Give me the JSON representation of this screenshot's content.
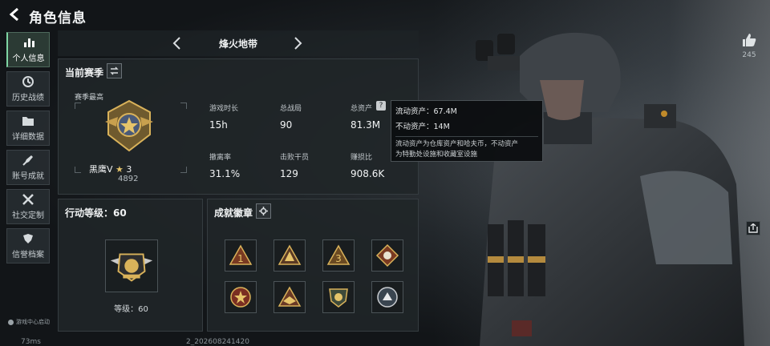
{
  "header": {
    "title": "角色信息",
    "back_icon": "back-arrow-icon"
  },
  "nav": {
    "items": [
      {
        "label": "个人信息",
        "icon": "bar-chart-icon",
        "active": true
      },
      {
        "label": "历史战绩",
        "icon": "history-clock-icon",
        "active": false
      },
      {
        "label": "详细数据",
        "icon": "folder-icon",
        "active": false
      },
      {
        "label": "账号成就",
        "icon": "rocket-icon",
        "active": false
      },
      {
        "label": "社交定制",
        "icon": "tools-icon",
        "active": false
      },
      {
        "label": "信誉档案",
        "icon": "shield-icon",
        "active": false
      }
    ],
    "game_center": "游戏中心启动"
  },
  "mode": {
    "title": "烽火地带"
  },
  "season": {
    "title": "当前赛季",
    "subtitle": "赛季最高",
    "rank_name": "黑鹰V",
    "rank_star": "★",
    "rank_stars": "3",
    "rank_score": "4892",
    "stats": [
      {
        "label": "游戏时长",
        "value": "15h"
      },
      {
        "label": "总战局",
        "value": "90"
      },
      {
        "label": "总资产",
        "value": "81.3M"
      },
      {
        "label": "撤离率",
        "value": "31.1%"
      },
      {
        "label": "击败干员",
        "value": "129"
      },
      {
        "label": "赚损比",
        "value": "908.6K"
      }
    ]
  },
  "tooltip": {
    "liquid": "流动资产：67.4M",
    "fixed": "不动资产：14M",
    "desc1": "流动资产为仓库资产和哈夫币，不动资产",
    "desc2": "为特勤处设施和收藏室设施"
  },
  "level": {
    "title": "行动等级：60",
    "label": "等级：60"
  },
  "achievements": {
    "title": "成就徽章",
    "badges": [
      "badge-1-icon",
      "badge-wolf-icon",
      "badge-3-icon",
      "badge-diamond-icon",
      "badge-star-icon",
      "badge-eagle-icon",
      "badge-shield-icon",
      "badge-circle-icon"
    ]
  },
  "social": {
    "like_count": "245"
  },
  "status": {
    "ping": "73ms",
    "id_suffix": "2_202608241420"
  },
  "colors": {
    "accent_green": "#7fd6a4",
    "gold": "#d9b25a",
    "panel": "#202528"
  }
}
